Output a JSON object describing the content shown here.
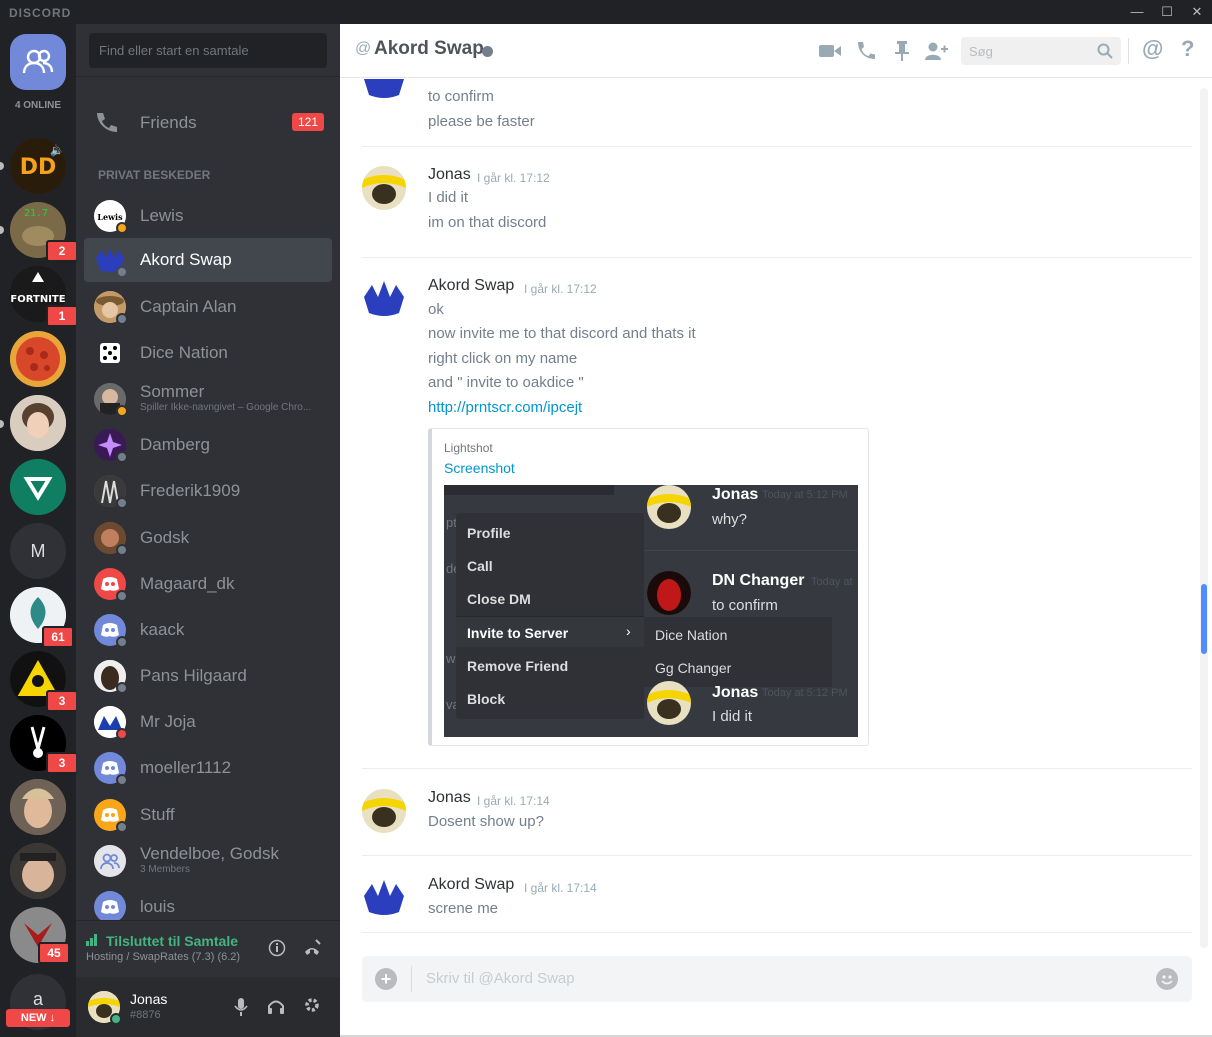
{
  "titlebar": {
    "logo": "DISCORD",
    "min": "—",
    "max": "☐",
    "close": "✕"
  },
  "guilds": {
    "online": "4 ONLINE",
    "badges": {
      "g2": "2",
      "fortnite": "1",
      "pump": "61",
      "toxic": "3",
      "black": "3",
      "last": "45"
    },
    "fortnite_text": "FORTNITE",
    "m_label": "M",
    "a_label": "a",
    "new_label": "NEW ↓"
  },
  "dm": {
    "search_placeholder": "Find eller start en samtale",
    "friends_label": "Friends",
    "friends_count": "121",
    "section_header": "PRIVAT BESKEDER",
    "items": [
      {
        "name": "Lewis"
      },
      {
        "name": "Akord Swap"
      },
      {
        "name": "Captain Alan"
      },
      {
        "name": "Dice Nation"
      },
      {
        "name": "Sommer",
        "sub": "Spiller Ikke-navngivet – Google Chro..."
      },
      {
        "name": "Damberg"
      },
      {
        "name": "Frederik1909"
      },
      {
        "name": "Godsk"
      },
      {
        "name": "Magaard_dk"
      },
      {
        "name": "kaack"
      },
      {
        "name": "Pans Hilgaard"
      },
      {
        "name": "Mr Joja"
      },
      {
        "name": "moeller1112"
      },
      {
        "name": "Stuff"
      },
      {
        "name": "Vendelboe, Godsk",
        "sub": "3 Members"
      },
      {
        "name": "louis"
      }
    ],
    "lewis_logo": "Lewis",
    "voice_title": "Tilsluttet til Samtale",
    "voice_sub": "Hosting / SwapRates (7.3) (6.2)",
    "user_name": "Jonas",
    "user_tag": "#8876"
  },
  "header": {
    "at": "@",
    "title": "Akord Swap",
    "search_placeholder": "Søg",
    "mention": "@",
    "help": "?"
  },
  "messages": {
    "g0": {
      "lines": [
        "to confirm",
        "please be faster"
      ]
    },
    "g1": {
      "author": "Jonas",
      "time": "I går kl. 17:12",
      "lines": [
        "I did it",
        "im on that discord"
      ]
    },
    "g2": {
      "author": "Akord Swap",
      "time": "I går kl. 17:12",
      "lines": [
        "ok",
        "now invite me to that discord and thats it",
        "right click on my name",
        "and \" invite to oakdice \""
      ],
      "link": "http://prntscr.com/ipcejt"
    },
    "embed": {
      "provider": "Lightshot",
      "title": "Screenshot",
      "menu": [
        "Profile",
        "Call",
        "Close DM",
        "Invite to Server",
        "Remove Friend",
        "Block"
      ],
      "submenu": [
        "Dice Nation",
        "Gg Changer"
      ],
      "side_letters": [
        "pt",
        "de",
        "wi",
        "va"
      ],
      "chat": [
        {
          "name": "Jonas",
          "time": "Today at 5:12 PM",
          "text": "why?"
        },
        {
          "name": "DN Changer",
          "time": "Today at",
          "text": "to confirm"
        },
        {
          "name": "Jonas",
          "time": "Today at 5:12 PM",
          "text": "I did it"
        }
      ]
    },
    "g3": {
      "author": "Jonas",
      "time": "I går kl. 17:14",
      "lines": [
        "Dosent show up?"
      ]
    },
    "g4": {
      "author": "Akord Swap",
      "time": "I går kl. 17:14",
      "lines": [
        "screne me"
      ]
    }
  },
  "composer": {
    "placeholder": "Skriv til @Akord Swap"
  },
  "colors": {
    "accent": "#7289da",
    "online": "#43b581",
    "idle": "#faa61a",
    "dnd": "#f04747",
    "link": "#0096cf",
    "badge": "#f04747"
  }
}
